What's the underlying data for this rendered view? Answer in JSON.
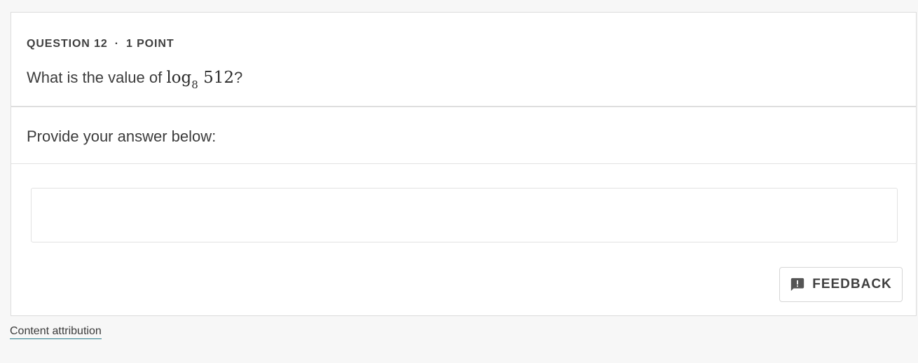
{
  "question": {
    "number_label": "QUESTION 12",
    "separator": "·",
    "points_label": "1 POINT",
    "text_before": "What is the value of ",
    "math_func": "log",
    "math_base": "8",
    "math_arg": "512",
    "text_after": "?"
  },
  "answer": {
    "prompt": "Provide your answer below:",
    "value": "",
    "placeholder": ""
  },
  "feedback": {
    "label": "FEEDBACK",
    "icon": "feedback-comment-exclamation-icon"
  },
  "footer": {
    "attribution_link": "Content attribution"
  },
  "colors": {
    "page_background": "#f7f7f7",
    "card_background": "#ffffff",
    "border": "#dcdcdc",
    "link_underline": "#2a7c8c",
    "icon": "#555555"
  }
}
